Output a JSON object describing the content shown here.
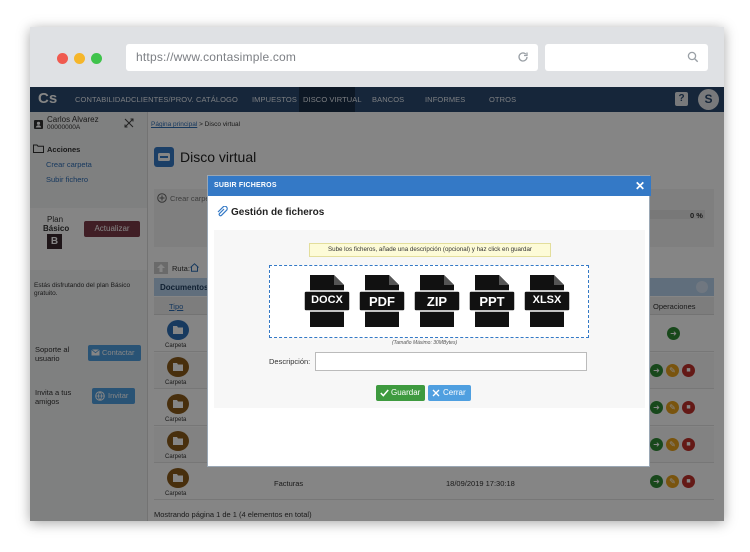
{
  "browser": {
    "url": "https://www.contasimple.com"
  },
  "nav": {
    "logo": "Cs",
    "items": [
      "CONTABILIDAD",
      "CLIENTES/PROV.",
      "CATÁLOGO",
      "IMPUESTOS",
      "DISCO VIRTUAL",
      "BANCOS",
      "INFORMES",
      "OTROS"
    ],
    "active": "DISCO VIRTUAL",
    "help": "?",
    "avatar": "S"
  },
  "sidebar": {
    "user_name": "Carlos Alvarez",
    "user_id": "00000000A",
    "acciones_title": "Acciones",
    "acciones": [
      "Crear carpeta",
      "Subir fichero"
    ],
    "plan_label": "Plan",
    "plan_name": "Básico",
    "plan_letter": "B",
    "upgrade_button": "Actualizar",
    "plan_note": "Estás disfrutando del plan Básico gratuito.",
    "support_label": "Soporte al usuario",
    "contact_button": "Contactar",
    "invite_label": "Invita a tus amigos",
    "invite_button": "Invitar"
  },
  "content": {
    "breadcrumb_link": "Página principal",
    "breadcrumb_current": "> Disco virtual",
    "page_title": "Disco virtual",
    "create_folder_button": "Crear carpeta",
    "progress_percent_label": "0 %",
    "route_label": "Ruta:",
    "table_title": "Documentos",
    "col_type": "Tipo",
    "col_operations": "Operaciones",
    "rows": [
      {
        "type": "Carpeta",
        "name": "",
        "date": ""
      },
      {
        "type": "Carpeta",
        "name": "",
        "date": ""
      },
      {
        "type": "Carpeta",
        "name": "",
        "date": ""
      },
      {
        "type": "Carpeta",
        "name": "",
        "date": ""
      },
      {
        "type": "Carpeta",
        "name": "Facturas",
        "date": "18/09/2019 17:30:18"
      }
    ],
    "footer": "Mostrando página 1 de 1 (4 elementos en total)"
  },
  "modal": {
    "header": "SUBIR FICHEROS",
    "section_title": "Gestión de ficheros",
    "hint": "Sube los ficheros, añade una descripción (opcional) y haz click en guardar",
    "file_types": [
      "DOCX",
      "PDF",
      "ZIP",
      "PPT",
      "XLSX"
    ],
    "max_size": "(Tamaño Máximo: 30MBytes)",
    "description_label": "Descripción:",
    "description_value": "",
    "save_button": "Guardar",
    "close_button": "Cerrar"
  },
  "colors": {
    "nav": "#2b4a6f",
    "modal_header": "#3479c6",
    "save": "#3e9a3f",
    "close": "#4f9fe0"
  }
}
